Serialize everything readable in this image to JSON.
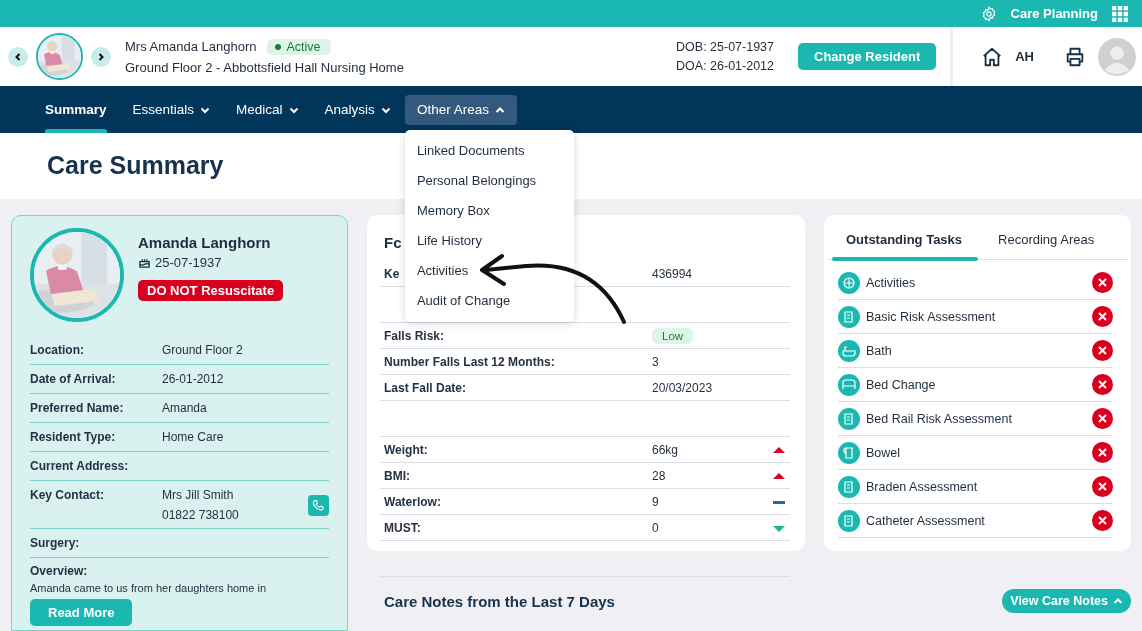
{
  "top_bar": {
    "app_name": "Care Planning"
  },
  "resident_header": {
    "name": "Mrs Amanda Langhorn",
    "status": "Active",
    "location": "Ground Floor 2 - Abbottsfield Hall Nursing Home",
    "dob": "DOB: 25-07-1937",
    "doa": "DOA: 26-01-2012",
    "change_button": "Change Resident",
    "initials": "AH"
  },
  "nav": {
    "tabs": [
      {
        "label": "Summary",
        "kind": "link",
        "selected": true,
        "expanded": false
      },
      {
        "label": "Essentials",
        "kind": "dropdown",
        "selected": false,
        "expanded": false
      },
      {
        "label": "Medical",
        "kind": "dropdown",
        "selected": false,
        "expanded": false
      },
      {
        "label": "Analysis",
        "kind": "dropdown",
        "selected": false,
        "expanded": false
      },
      {
        "label": "Other Areas",
        "kind": "dropdown",
        "selected": false,
        "expanded": true
      }
    ]
  },
  "dropdown_menu": {
    "items": [
      "Linked Documents",
      "Personal Belongings",
      "Memory Box",
      "Life History",
      "Activities",
      "Audit of Change"
    ]
  },
  "page_title": "Care Summary",
  "profile_card": {
    "name": "Amanda Langhorn",
    "dob": "25-07-1937",
    "alert": "DO NOT Resuscitate",
    "fields": [
      {
        "label": "Location:",
        "values": [
          "Ground Floor 2"
        ],
        "kind": "text"
      },
      {
        "label": "Date of Arrival:",
        "values": [
          "26-01-2012"
        ],
        "kind": "text"
      },
      {
        "label": "Preferred Name:",
        "values": [
          "Amanda"
        ],
        "kind": "text"
      },
      {
        "label": "Resident Type:",
        "values": [
          "Home Care"
        ],
        "kind": "text"
      },
      {
        "label": "Current Address:",
        "kind": "text"
      },
      {
        "label": "Key Contact:",
        "values": [
          "Mrs Jill Smith",
          "01822 738100"
        ],
        "kind": "contact"
      },
      {
        "label": "Surgery:",
        "kind": "text"
      }
    ],
    "overview": {
      "label": "Overview:",
      "text": "Amanda came to us from her daughters home in"
    },
    "read_more": "Read More"
  },
  "falls_card": {
    "heading": "Fc",
    "rows": [
      {
        "kind": "text",
        "label": "Ke",
        "value": "436994"
      },
      {
        "kind": "blank"
      },
      {
        "kind": "badge",
        "label": "Falls Risk:",
        "value": "Low"
      },
      {
        "kind": "text",
        "label": "Number Falls Last 12 Months:",
        "value": "3"
      },
      {
        "kind": "text",
        "label": "Last Fall Date:",
        "value": "20/03/2023"
      },
      {
        "kind": "blank"
      },
      {
        "kind": "rising",
        "label": "Weight:",
        "value": "66kg"
      },
      {
        "kind": "rising",
        "label": "BMI:",
        "value": "28"
      },
      {
        "kind": "steady",
        "label": "Waterlow:",
        "value": "9"
      },
      {
        "kind": "falling",
        "label": "MUST:",
        "value": "0"
      },
      {
        "kind": "blank"
      }
    ]
  },
  "tasks_card": {
    "tabs": [
      {
        "label": "Outstanding Tasks",
        "selected": true
      },
      {
        "label": "Recording Areas",
        "selected": false
      }
    ],
    "tasks": [
      {
        "label": "Activities",
        "kind": "ball"
      },
      {
        "label": "Basic Risk Assessment",
        "kind": "form"
      },
      {
        "label": "Bath",
        "kind": "bath"
      },
      {
        "label": "Bed Change",
        "kind": "bed"
      },
      {
        "label": "Bed Rail Risk Assessment",
        "kind": "form"
      },
      {
        "label": "Bowel",
        "kind": "roll"
      },
      {
        "label": "Braden Assessment",
        "kind": "form"
      },
      {
        "label": "Catheter Assessment",
        "kind": "form"
      }
    ]
  },
  "care_notes": {
    "title": "Care Notes from the Last 7 Days",
    "button": "View Care Notes"
  }
}
